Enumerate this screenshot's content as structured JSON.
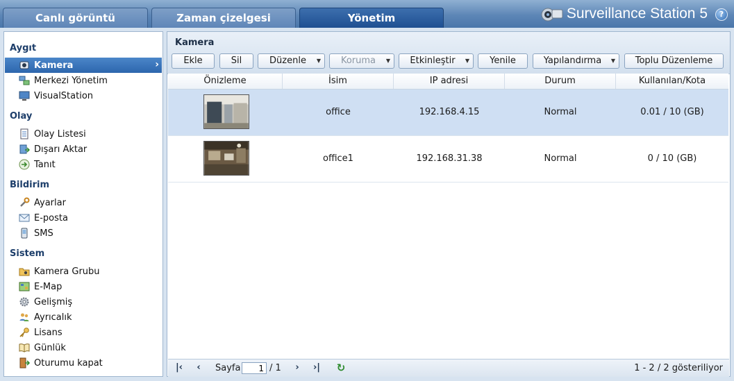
{
  "tabs": [
    {
      "label": "Canlı görüntü"
    },
    {
      "label": "Zaman çizelgesi"
    },
    {
      "label": "Yönetim"
    }
  ],
  "brand": {
    "title": "Surveillance Station 5",
    "help_label": "?"
  },
  "sidebar": {
    "sections": [
      {
        "title": "Aygıt",
        "items": [
          {
            "label": "Kamera",
            "icon": "camera-icon"
          },
          {
            "label": "Merkezi Yönetim",
            "icon": "central-management-icon"
          },
          {
            "label": "VisualStation",
            "icon": "monitor-icon"
          }
        ]
      },
      {
        "title": "Olay",
        "items": [
          {
            "label": "Olay Listesi",
            "icon": "event-list-icon"
          },
          {
            "label": "Dışarı Aktar",
            "icon": "export-icon"
          },
          {
            "label": "Tanıt",
            "icon": "import-icon"
          }
        ]
      },
      {
        "title": "Bildirim",
        "items": [
          {
            "label": "Ayarlar",
            "icon": "wrench-icon"
          },
          {
            "label": "E-posta",
            "icon": "envelope-icon"
          },
          {
            "label": "SMS",
            "icon": "phone-icon"
          }
        ]
      },
      {
        "title": "Sistem",
        "items": [
          {
            "label": "Kamera Grubu",
            "icon": "folder-camera-icon"
          },
          {
            "label": "E-Map",
            "icon": "map-icon"
          },
          {
            "label": "Gelişmiş",
            "icon": "gear-icon"
          },
          {
            "label": "Ayrıcalık",
            "icon": "users-icon"
          },
          {
            "label": "Lisans",
            "icon": "key-icon"
          },
          {
            "label": "Günlük",
            "icon": "book-icon"
          },
          {
            "label": "Oturumu kapat",
            "icon": "logout-door-icon"
          }
        ]
      }
    ]
  },
  "main": {
    "title": "Kamera",
    "toolbar": {
      "add": "Ekle",
      "delete": "Sil",
      "edit": "Düzenle",
      "protect": "Koruma",
      "enable": "Etkinleştir",
      "refresh": "Yenile",
      "configure": "Yapılandırma",
      "bulk_edit": "Toplu Düzenleme"
    },
    "columns": [
      "Önizleme",
      "İsim",
      "IP adresi",
      "Durum",
      "Kullanılan/Kota"
    ],
    "rows": [
      {
        "name": "office",
        "ip": "192.168.4.15",
        "status": "Normal",
        "usage": "0.01 / 10 (GB)"
      },
      {
        "name": "office1",
        "ip": "192.168.31.38",
        "status": "Normal",
        "usage": "0 / 10 (GB)"
      }
    ],
    "pager": {
      "page_label": "Sayfa",
      "page_value": "1",
      "page_total": "/ 1",
      "summary": "1 - 2 / 2 gösteriliyor"
    }
  },
  "colors": {
    "accent": "#2d66ad",
    "topbar": "#5d86b6",
    "selected_row": "#cfdff3"
  }
}
